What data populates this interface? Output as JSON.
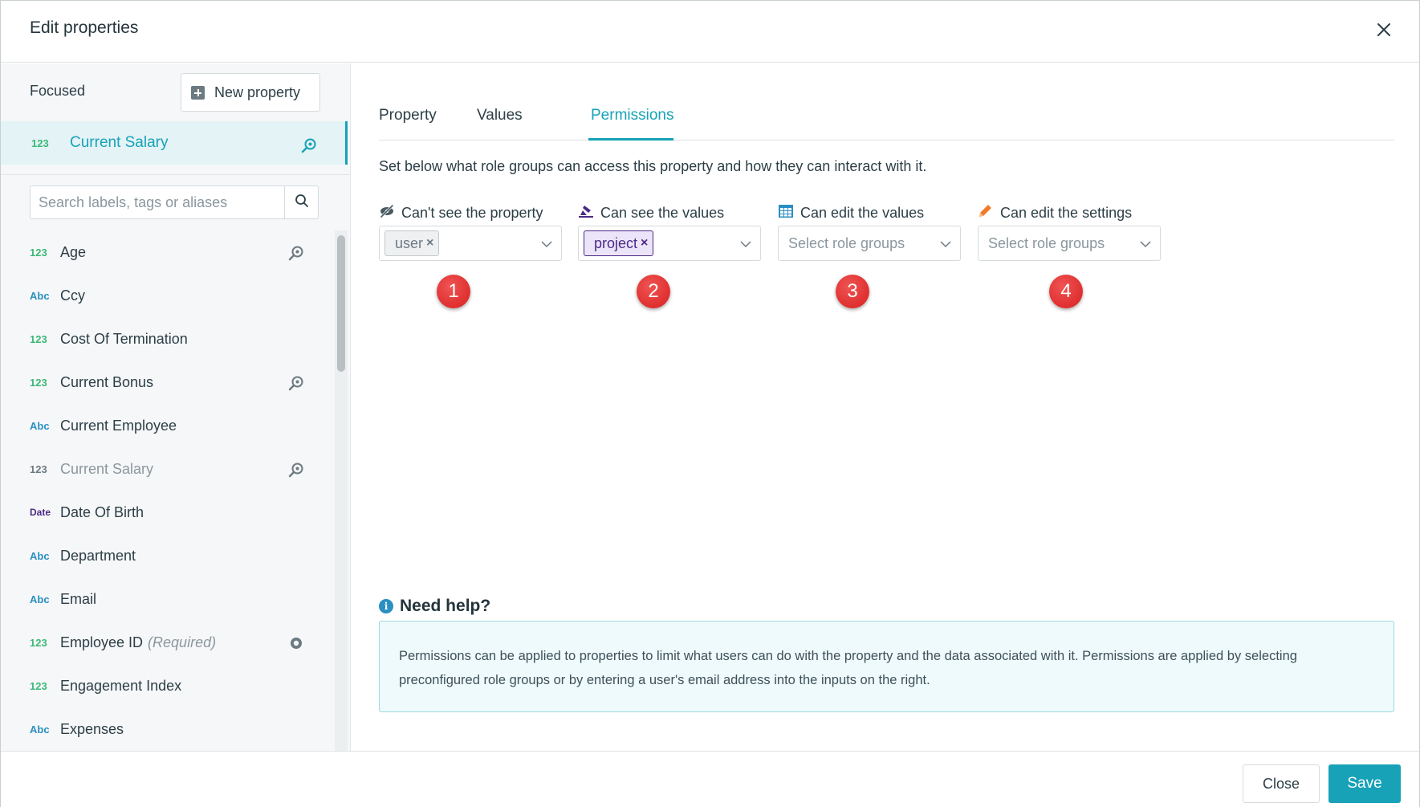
{
  "dialog": {
    "title": "Edit properties"
  },
  "sidebar": {
    "focused_label": "Focused",
    "new_property_label": "New property",
    "focused_item": {
      "type": "123",
      "name": "Current Salary"
    },
    "search_placeholder": "Search labels, tags or aliases",
    "items": [
      {
        "type": "123",
        "name": "Age",
        "icon": "magnify-icon"
      },
      {
        "type": "Abc",
        "name": "Ccy"
      },
      {
        "type": "123",
        "name": "Cost Of Termination"
      },
      {
        "type": "123",
        "name": "Current Bonus",
        "icon": "magnify-icon"
      },
      {
        "type": "Abc",
        "name": "Current Employee"
      },
      {
        "type": "123",
        "name": "Current Salary",
        "icon": "magnify-icon"
      },
      {
        "type": "Date",
        "name": "Date Of Birth"
      },
      {
        "type": "Abc",
        "name": "Department"
      },
      {
        "type": "Abc",
        "name": "Email"
      },
      {
        "type": "123",
        "name": "Employee ID",
        "note": "(Required)",
        "icon": "target-icon"
      },
      {
        "type": "123",
        "name": "Engagement Index"
      },
      {
        "type": "Abc",
        "name": "Expenses"
      }
    ]
  },
  "tabs": [
    {
      "label": "Property"
    },
    {
      "label": "Values"
    },
    {
      "label": "Permissions"
    }
  ],
  "permissions": {
    "description": "Set below what role groups can access this property and how they can interact with it.",
    "columns": [
      {
        "label": "Can't see the property",
        "icon": "eye-slash-icon",
        "tag": "user",
        "placeholder": ""
      },
      {
        "label": "Can see the values",
        "icon": "brush-icon",
        "tag": "project",
        "placeholder": ""
      },
      {
        "label": "Can edit the values",
        "icon": "table-icon",
        "tag": "",
        "placeholder": "Select role groups"
      },
      {
        "label": "Can edit the settings",
        "icon": "pencil-icon",
        "tag": "",
        "placeholder": "Select role groups"
      }
    ],
    "badges": [
      "1",
      "2",
      "3",
      "4"
    ]
  },
  "help": {
    "title": "Need help?",
    "text_line1": "Permissions can be applied to properties to limit what users can do with the property and the data associated with it. Permissions are applied by selecting",
    "text_line2": "preconfigured role groups or by entering a user's email address into the inputs on the right."
  },
  "footer": {
    "close_label": "Close",
    "save_label": "Save"
  },
  "colors": {
    "accent": "#17a2b8",
    "number_type": "#3cb878",
    "text_type": "#2a8fc2",
    "date_type": "#4b2a86",
    "badge": "#e02a2a"
  }
}
